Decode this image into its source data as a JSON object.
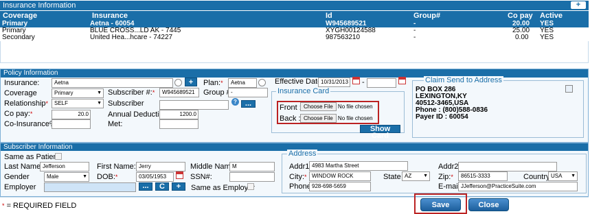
{
  "insurance_info": {
    "title": "Insurance Information",
    "add_label": "+",
    "columns": [
      "Coverage",
      "Insurance",
      "Id",
      "Group#",
      "Co pay",
      "Active"
    ],
    "rows": [
      [
        "Primary",
        "Aetna - 60054",
        "W945689521",
        "-",
        "20.00",
        "YES"
      ],
      [
        "Primary",
        "BLUE CROSS...LD AK - 7445",
        "XYGH00124588",
        "-",
        "25.00",
        "YES"
      ],
      [
        "Secondary",
        "United Hea...hcare - 74227",
        "987563210",
        "-",
        "0.00",
        "YES"
      ]
    ]
  },
  "policy": {
    "title": "Policy Information",
    "insurance_label": "Insurance:",
    "insurance_value": "Aetna",
    "insurance_add": "+",
    "plan_label": "Plan:",
    "plan_value": "Aetna",
    "effective_label": "Effective Dates:",
    "effective_from": "10/31/2013",
    "effective_sep": "-",
    "effective_to": "",
    "coverage_label": "Coverage",
    "coverage_value": "Primary",
    "subscriber_no_label": "Subscriber #:",
    "subscriber_no_value": "W945689521",
    "group_label": "Group #:",
    "group_value": "-",
    "relationship_label": "Relationship",
    "relationship_value": "SELF",
    "subscriber_label": "Subscriber",
    "subscriber_value": "",
    "subscriber_btn": "...",
    "copay_label": "Co pay:",
    "copay_value": "20.0",
    "deductible_label": "Annual Deductible",
    "deductible_value": "1200.0",
    "coinsurance_label": "Co-Insurance%",
    "coinsurance_value": "",
    "met_label": "Met:",
    "met_value": "",
    "card": {
      "title": "Insurance Card",
      "front_label": "Front :",
      "back_label": "Back :",
      "choose_label": "Choose File",
      "no_file": "No file chosen",
      "show_btn": "Show Card"
    },
    "claim": {
      "title": "Claim Send to Address",
      "line1": "PO BOX 286",
      "line2": "LEXINGTON,KY",
      "line3": "40512-3465,USA",
      "phone": "Phone : (800)588-0836",
      "payer": "Payer ID : 60054"
    }
  },
  "subscriber": {
    "title": "Subscriber Information",
    "same_patient_label": "Same as Patient",
    "last_label": "Last Name:",
    "last_value": "Jefferson",
    "first_label": "First Name:",
    "first_value": "Jerry",
    "middle_label": "Middle Name:",
    "middle_value": "M",
    "gender_label": "Gender",
    "gender_value": "Male",
    "dob_label": "DOB:",
    "dob_value": "03/05/1953",
    "ssn_label": "SSN#:",
    "ssn_value": "",
    "employer_label": "Employer",
    "employer_value": "",
    "emp_btn1": "...",
    "emp_btn2": "C",
    "emp_btn3": "+",
    "same_employer_label": "Same as Employer",
    "address": {
      "title": "Address",
      "addr1_label": "Addr1.",
      "addr1_value": "4983 Martha Street",
      "addr2_label": "Addr2.",
      "addr2_value": "",
      "city_label": "City:",
      "city_value": "WINDOW ROCK",
      "state_label": "State",
      "state_value": "AZ",
      "zip_label": "Zip:",
      "zip_value": "86515-3333",
      "country_label": "Country",
      "country_value": "USA",
      "phone_label": "Phone:",
      "phone_value": "928-698-5659",
      "email_label": "E-mail:",
      "email_value": "JJefferson@PracticeSuite.com"
    }
  },
  "footer": {
    "required_note": "= REQUIRED FIELD",
    "required_star": "*",
    "save": "Save",
    "close": "Close"
  }
}
